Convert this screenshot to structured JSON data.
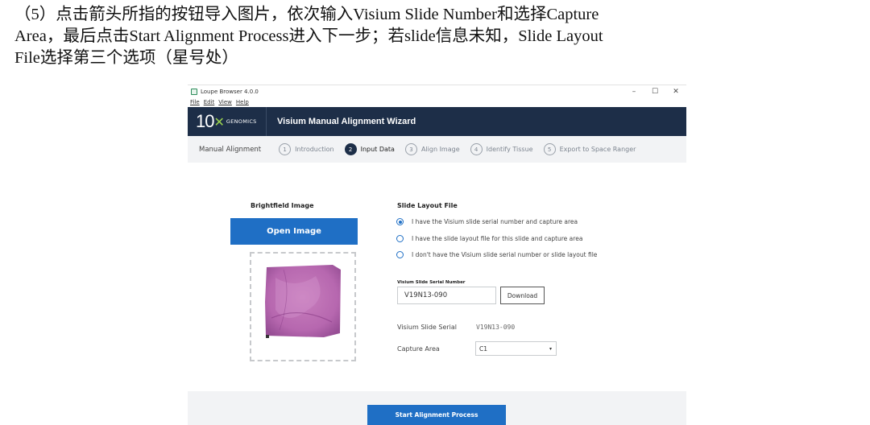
{
  "caption": {
    "line1": "（5）点击箭头所指的按钮导入图片，依次输入Visium Slide Number和选择Capture",
    "line2": "Area，最后点击Start Alignment Process进入下一步；若slide信息未知，Slide Layout",
    "line3": "File选择第三个选项（星号处）"
  },
  "window": {
    "title": "Loupe Browser 4.0.0",
    "controls": {
      "minimize": "–",
      "maximize": "☐",
      "close": "✕"
    },
    "menu": [
      "File",
      "Edit",
      "View",
      "Help"
    ]
  },
  "header": {
    "logo_ten": "10",
    "logo_x": "✕",
    "logo_genomics": "GENOMICS",
    "title": "Visium Manual Alignment Wizard"
  },
  "steps": {
    "lead": "Manual Alignment",
    "items": [
      {
        "num": "1",
        "label": "Introduction"
      },
      {
        "num": "2",
        "label": "Input Data"
      },
      {
        "num": "3",
        "label": "Align Image"
      },
      {
        "num": "4",
        "label": "Identify Tissue"
      },
      {
        "num": "5",
        "label": "Export to Space Ranger"
      }
    ],
    "active_index": 1
  },
  "brightfield": {
    "title": "Brightfield Image",
    "open_button": "Open Image"
  },
  "layout": {
    "title": "Slide Layout File",
    "options": [
      "I have the Visium slide serial number and capture area",
      "I have the slide layout file for this slide and capture area",
      "I don't have the Visium slide serial number or slide layout file"
    ],
    "selected_index": 0,
    "serial_label": "Visium Slide Serial Number",
    "serial_value": "V19N13-090",
    "download_button": "Download",
    "serial_display_label": "Visium Slide Serial",
    "serial_display_value": "V19N13-090",
    "capture_label": "Capture Area",
    "capture_value": "C1",
    "caret": "▾"
  },
  "footer": {
    "start_button": "Start Alignment Process"
  },
  "colors": {
    "header_bg": "#1d2e48",
    "accent_blue": "#1f6fc5",
    "logo_green": "#9ad14f",
    "tissue": "#b05aa8"
  }
}
